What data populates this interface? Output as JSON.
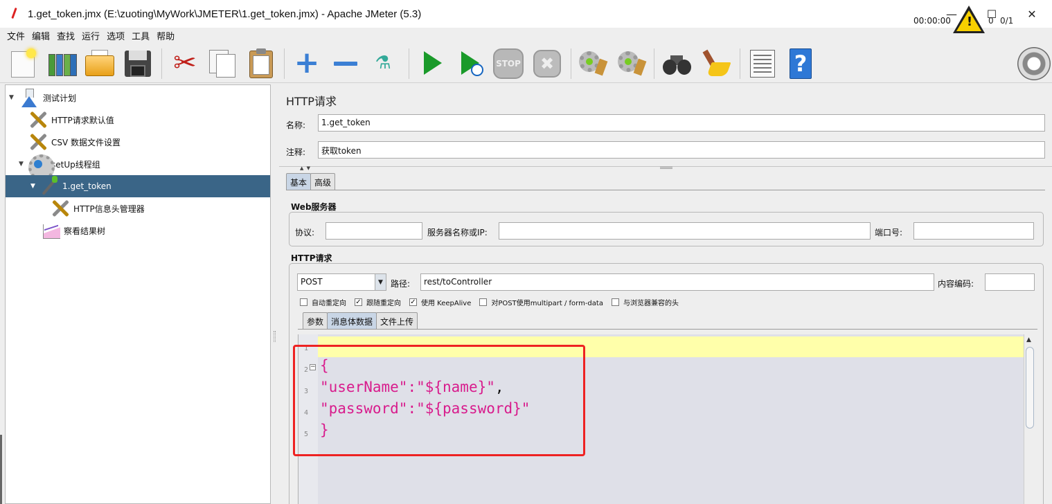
{
  "window": {
    "title": "1.get_token.jmx (E:\\zuoting\\MyWork\\JMETER\\1.get_token.jmx) - Apache JMeter (5.3)",
    "minimize": "—",
    "maximize": "☐",
    "close": "✕"
  },
  "menu": [
    "文件",
    "编辑",
    "查找",
    "运行",
    "选项",
    "工具",
    "帮助"
  ],
  "toolbar": {
    "timer": "00:00:00",
    "error_count": "0",
    "threads": "0/1",
    "stop_label": "STOP",
    "shutdown_label": "✖",
    "help_label": "?",
    "warning_mark": "!"
  },
  "tree": {
    "nodes": [
      {
        "label": "测试计划",
        "expander": "▼"
      },
      {
        "label": "HTTP请求默认值"
      },
      {
        "label": "CSV 数据文件设置"
      },
      {
        "label": "setUp线程组",
        "expander": "▼"
      },
      {
        "label": "1.get_token",
        "expander": "▼",
        "selected": true
      },
      {
        "label": "HTTP信息头管理器"
      },
      {
        "label": "察看结果树"
      }
    ]
  },
  "sampler": {
    "panel_title": "HTTP请求",
    "name_label": "名称:",
    "name_value": "1.get_token",
    "comment_label": "注释:",
    "comment_value": "获取token",
    "tabs": [
      "基本",
      "高级"
    ],
    "web_server": {
      "title": "Web服务器",
      "protocol_label": "协议:",
      "protocol_value": "",
      "server_label": "服务器名称或IP:",
      "server_value": "",
      "port_label": "端口号:",
      "port_value": ""
    },
    "http_request": {
      "title": "HTTP请求",
      "method": "POST",
      "path_label": "路径:",
      "path_value": "rest/toController",
      "encoding_label": "内容编码:",
      "encoding_value": "",
      "options": [
        {
          "label": "自动重定向",
          "checked": false
        },
        {
          "label": "跟随重定向",
          "checked": true
        },
        {
          "label": "使用 KeepAlive",
          "checked": true
        },
        {
          "label": "对POST使用multipart / form-data",
          "checked": false
        },
        {
          "label": "与浏览器兼容的头",
          "checked": false
        }
      ],
      "body_tabs": [
        "参数",
        "消息体数据",
        "文件上传"
      ]
    },
    "body": {
      "line_numbers": [
        "1",
        "2",
        "3",
        "4",
        "5"
      ],
      "line2_brace": "{",
      "line3_key": "\"userName\"",
      "line3_colon": ":",
      "line3_value": "\"${name}\"",
      "line3_comma": ",",
      "line4_key": "\"password\"",
      "line4_colon": ":",
      "line4_value": "\"${password}\"",
      "line5_brace": "}"
    }
  },
  "colors": {
    "selection": "#3a6587",
    "json_text": "#d81b8c",
    "highlight_box": "#ee2222",
    "current_line": "#ffffaa"
  }
}
